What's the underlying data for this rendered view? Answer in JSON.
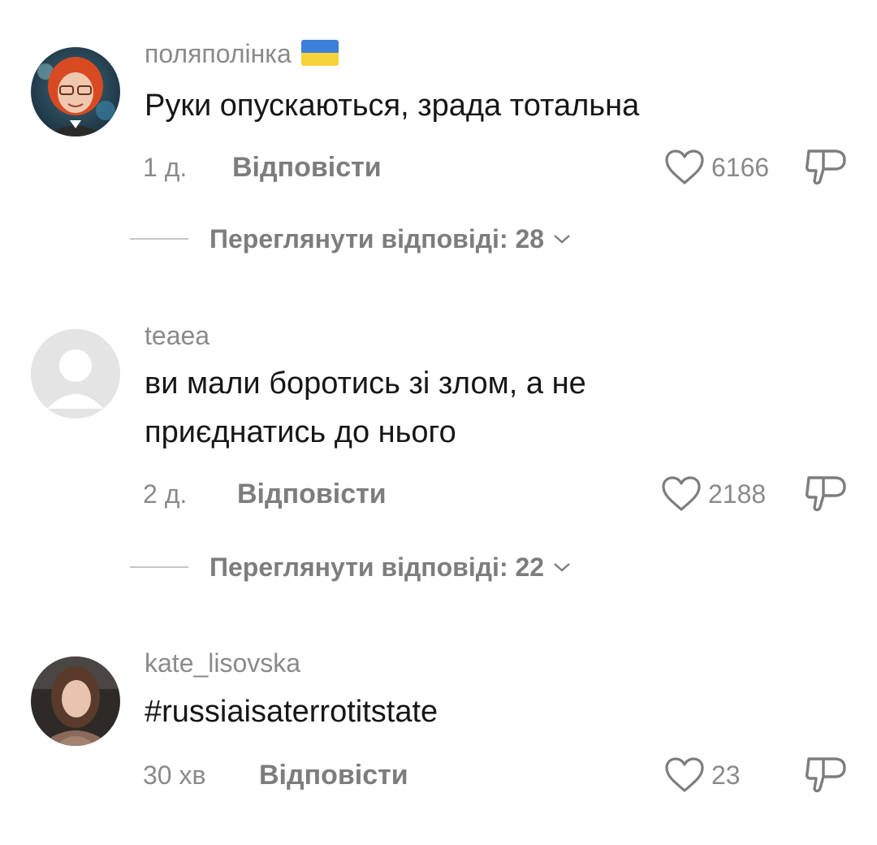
{
  "comments": [
    {
      "username": "поляполінка",
      "has_flag": true,
      "text": "Руки опускаються, зрада тотальна",
      "time": "1 д.",
      "reply_label": "Відповісти",
      "likes": "6166",
      "view_replies_label": "Переглянути відповіді: 28"
    },
    {
      "username": "teaea",
      "text": "ви мали боротись зі злом, а не приєднатись до нього",
      "time": "2 д.",
      "reply_label": "Відповісти",
      "likes": "2188",
      "view_replies_label": "Переглянути відповіді: 22"
    },
    {
      "username": "kate_lisovska",
      "text": "#russiaisaterrotitstate",
      "time": "30 хв",
      "reply_label": "Відповісти",
      "likes": "23"
    }
  ],
  "colors": {
    "flag_blue": "#3d7fd8",
    "flag_yellow": "#f5d23a",
    "default_avatar_bg": "#e4e4e4"
  },
  "icons": {
    "like": "heart-outline-icon",
    "dislike": "thumbs-down-icon",
    "expand": "chevron-down-icon"
  }
}
